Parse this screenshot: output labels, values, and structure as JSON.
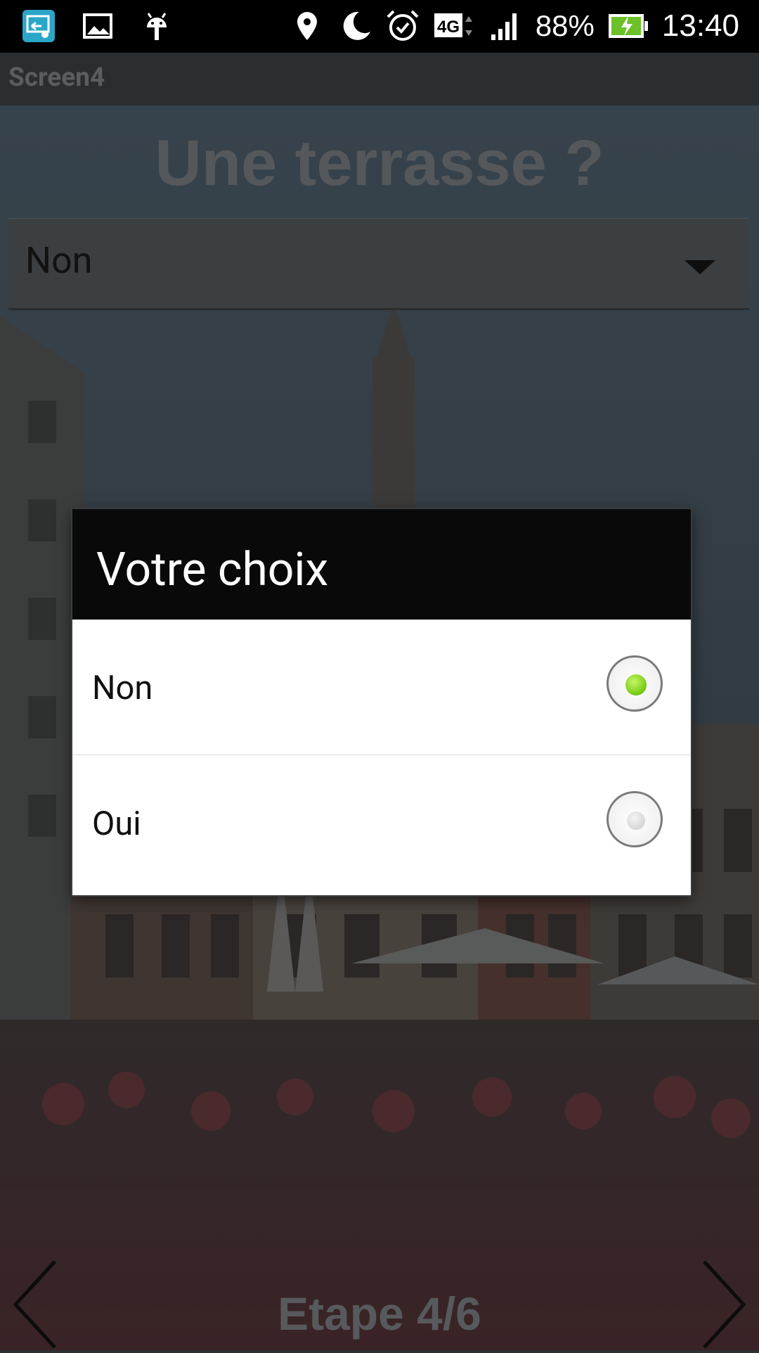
{
  "status_bar": {
    "icons_left": [
      "screen-cast-icon",
      "image-icon",
      "android-debug-icon"
    ],
    "icons_right": [
      "location-icon",
      "moon-icon",
      "alarm-icon",
      "network-4g-icon",
      "signal-icon"
    ],
    "network": "4G",
    "battery_percent": "88%",
    "time": "13:40"
  },
  "action_bar": {
    "title": "Screen4"
  },
  "screen": {
    "title": "Une terrasse ?",
    "spinner_value": "Non",
    "step": "Etape 4/6"
  },
  "dialog": {
    "title": "Votre choix",
    "options": [
      {
        "label": "Non",
        "selected": true
      },
      {
        "label": "Oui",
        "selected": false
      }
    ]
  },
  "colors": {
    "radio_selected": "#7fd11a",
    "dialog_header": "#090909",
    "overlay_text": "#55585a"
  }
}
